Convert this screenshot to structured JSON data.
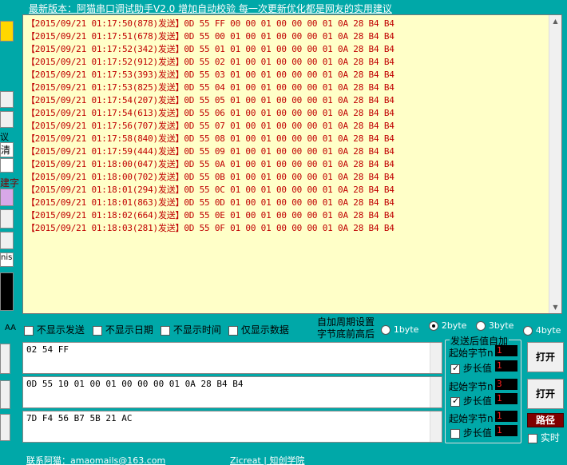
{
  "header": {
    "version_notice": "最新版本：阿猫串口调试助手V2.0 增加自动校验 每一次更新优化都是网友的实用建议"
  },
  "left_panel": {
    "frag_1": "议",
    "frag_2": "清",
    "frag_3": "建字",
    "frag_4": "nis",
    "frag_5": "AA"
  },
  "log": {
    "lines": [
      "【2015/09/21 01:17:50(878)发送】0D 55 FF 00 00 01 00 00 00 01 0A 28 B4 B4",
      "【2015/09/21 01:17:51(678)发送】0D 55 00 01 00 01 00 00 00 01 0A 28 B4 B4",
      "【2015/09/21 01:17:52(342)发送】0D 55 01 01 00 01 00 00 00 01 0A 28 B4 B4",
      "【2015/09/21 01:17:52(912)发送】0D 55 02 01 00 01 00 00 00 01 0A 28 B4 B4",
      "【2015/09/21 01:17:53(393)发送】0D 55 03 01 00 01 00 00 00 01 0A 28 B4 B4",
      "【2015/09/21 01:17:53(825)发送】0D 55 04 01 00 01 00 00 00 01 0A 28 B4 B4",
      "【2015/09/21 01:17:54(207)发送】0D 55 05 01 00 01 00 00 00 01 0A 28 B4 B4",
      "【2015/09/21 01:17:54(613)发送】0D 55 06 01 00 01 00 00 00 01 0A 28 B4 B4",
      "【2015/09/21 01:17:56(707)发送】0D 55 07 01 00 01 00 00 00 01 0A 28 B4 B4",
      "【2015/09/21 01:17:58(840)发送】0D 55 08 01 00 01 00 00 00 01 0A 28 B4 B4",
      "【2015/09/21 01:17:59(444)发送】0D 55 09 01 00 01 00 00 00 01 0A 28 B4 B4",
      "【2015/09/21 01:18:00(047)发送】0D 55 0A 01 00 01 00 00 00 01 0A 28 B4 B4",
      "【2015/09/21 01:18:00(702)发送】0D 55 0B 01 00 01 00 00 00 01 0A 28 B4 B4",
      "【2015/09/21 01:18:01(294)发送】0D 55 0C 01 00 01 00 00 00 01 0A 28 B4 B4",
      "【2015/09/21 01:18:01(863)发送】0D 55 0D 01 00 01 00 00 00 01 0A 28 B4 B4",
      "【2015/09/21 01:18:02(664)发送】0D 55 0E 01 00 01 00 00 00 01 0A 28 B4 B4",
      "【2015/09/21 01:18:03(281)发送】0D 55 0F 01 00 01 00 00 00 01 0A 28 B4 B4"
    ]
  },
  "options": {
    "hide_send": "不显示发送",
    "hide_date": "不显示日期",
    "hide_time": "不显示时间",
    "data_only": "仅显示数据",
    "periodic_line1": "自加周期设置",
    "periodic_line2": "字节底前高后",
    "byte_options": [
      "1byte",
      "2byte",
      "3byte",
      "4byte"
    ],
    "byte_selected": "2byte"
  },
  "send_fields": [
    {
      "value": "02 54 FF"
    },
    {
      "value": "0D 55 10 01 00 01 00 00 00 01 0A 28 B4 B4"
    },
    {
      "value": "7D F4 56 B7 5B 21 AC"
    }
  ],
  "auto_inc": {
    "title": "发送后值自加",
    "rows": [
      {
        "start_label": "起始字节n",
        "start_value": "1",
        "step_label": "步长值",
        "step_value": "1",
        "checked": true
      },
      {
        "start_label": "起始字节n",
        "start_value": "3",
        "step_label": "步长值",
        "step_value": "1",
        "checked": true
      },
      {
        "start_label": "起始字节n",
        "start_value": "1",
        "step_label": "步长值",
        "step_value": "1",
        "checked": false
      }
    ]
  },
  "buttons": {
    "open_1": "打开",
    "open_2": "打开",
    "path": "路径",
    "realtime": "实时"
  },
  "footer": {
    "contact": "联系阿猫：amaomails@163.com",
    "site": "Zicreat | 知创学院"
  },
  "colors": {
    "background": "#00a8a8",
    "log_bg": "#ffffc8",
    "log_text": "#c00000",
    "accent_yellow": "#ffd700",
    "accent_purple": "#d8a8e8"
  }
}
